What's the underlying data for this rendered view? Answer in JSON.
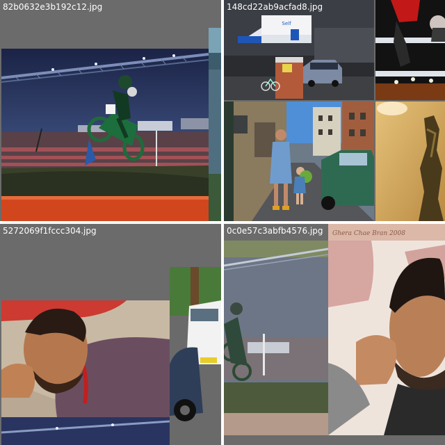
{
  "tiles": [
    {
      "filename": "82b0632e3b192c12.jpg"
    },
    {
      "filename": "148cd22ab9acfad8.jpg"
    },
    {
      "filename": "5272069f1fccc304.jpg"
    },
    {
      "filename": "0c0e57c3abfb4576.jpg"
    }
  ],
  "signs": {
    "self_label": "Self",
    "artwork_caption": "Ghera Chae Bran 2008"
  },
  "colors": {
    "label_text": "#ffffff",
    "empty_cell": "#6b6b6b",
    "divider": "#ffffff"
  }
}
